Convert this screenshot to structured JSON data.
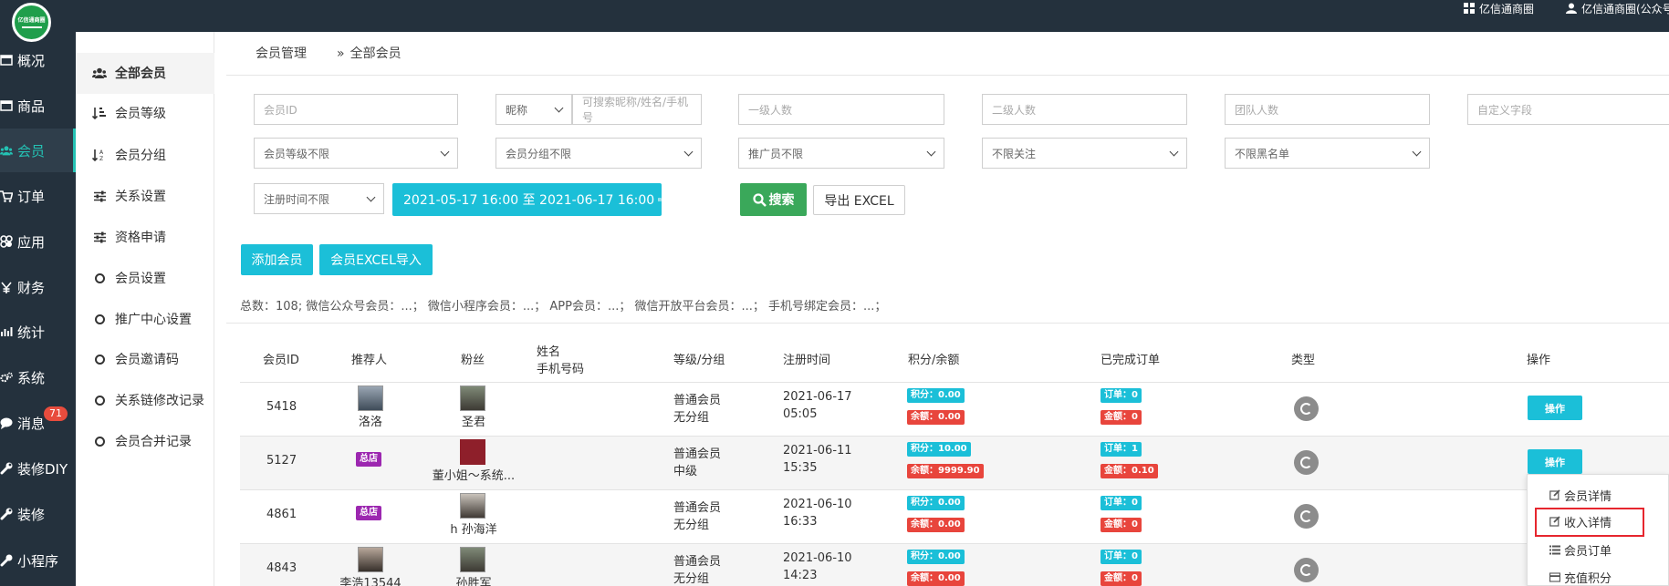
{
  "topbar": {
    "shop_link": "亿信通商圈",
    "account_link": "亿信通商圈(公众号"
  },
  "logo": {
    "text": "亿信通商圈"
  },
  "nav": [
    {
      "label": "概况",
      "icon": "dashboard-icon"
    },
    {
      "label": "商品",
      "icon": "goods-icon"
    },
    {
      "label": "会员",
      "icon": "users-icon",
      "active": true
    },
    {
      "label": "订单",
      "icon": "cart-icon"
    },
    {
      "label": "应用",
      "icon": "apps-icon"
    },
    {
      "label": "财务",
      "icon": "yen-icon"
    },
    {
      "label": "统计",
      "icon": "bar-chart-icon"
    },
    {
      "label": "系统",
      "icon": "gears-icon"
    },
    {
      "label": "消息",
      "icon": "chat-icon",
      "badge": "71"
    },
    {
      "label": "装修DIY",
      "icon": "wrench-icon"
    },
    {
      "label": "装修",
      "icon": "wrench-icon"
    },
    {
      "label": "小程序",
      "icon": "mini-program-icon"
    }
  ],
  "subnav": [
    {
      "label": "全部会员",
      "icon": "users-icon",
      "active": true
    },
    {
      "label": "会员等级",
      "icon": "sort-amount-icon"
    },
    {
      "label": "会员分组",
      "icon": "sort-alpha-icon"
    },
    {
      "label": "关系设置",
      "icon": "sliders-icon"
    },
    {
      "label": "资格申请",
      "icon": "sliders-icon"
    },
    {
      "label": "会员设置",
      "icon": "circle-icon"
    },
    {
      "label": "推广中心设置",
      "icon": "circle-icon"
    },
    {
      "label": "会员邀请码",
      "icon": "circle-icon"
    },
    {
      "label": "关系链修改记录",
      "icon": "circle-icon"
    },
    {
      "label": "会员合并记录",
      "icon": "circle-icon"
    }
  ],
  "breadcrumb": {
    "parent": "会员管理",
    "separator": "»",
    "current": "全部会员"
  },
  "filters": {
    "member_id_placeholder": "会员ID",
    "nickname_select": "昵称",
    "nickname_placeholder": "可搜索昵称/姓名/手机号",
    "level1_placeholder": "一级人数",
    "level2_placeholder": "二级人数",
    "team_placeholder": "团队人数",
    "custom_placeholder": "自定义字段",
    "member_level_select": "会员等级不限",
    "member_group_select": "会员分组不限",
    "promoter_select": "推广员不限",
    "follow_select": "不限关注",
    "blacklist_select": "不限黑名单",
    "register_time_select": "注册时间不限",
    "date_range": "2021-05-17 16:00 至 2021-06-17 16:00",
    "search_button": "搜索",
    "export_button": "导出 EXCEL"
  },
  "actions": {
    "add_member": "添加会员",
    "import_excel": "会员EXCEL导入"
  },
  "summary": "总数：108; 微信公众号会员：...； 微信小程序会员：...； APP会员：...； 微信开放平台会员：...； 手机号绑定会员：...；",
  "table": {
    "headers": {
      "member_id": "会员ID",
      "referrer": "推荐人",
      "fans": "粉丝",
      "name": "姓名",
      "phone": "手机号码",
      "level_group": "等级/分组",
      "register_time": "注册时间",
      "points_balance": "积分/余额",
      "orders": "已完成订单",
      "type": "类型",
      "operation": "操作"
    },
    "rows": [
      {
        "id": "5418",
        "referrer": "洛洛",
        "referrer_badge": "",
        "fan": "圣君",
        "level": "普通会员",
        "group": "无分组",
        "date": "2021-06-17",
        "time": "05:05",
        "points": "积分：0.00",
        "balance": "余额：0.00",
        "order_count": "订单：0",
        "order_amount": "金额：0",
        "op": "操作"
      },
      {
        "id": "5127",
        "referrer": "",
        "referrer_badge": "总店",
        "fan": "董小姐～系统...",
        "level": "普通会员",
        "group": "中级",
        "date": "2021-06-11",
        "time": "15:35",
        "points": "积分：10.00",
        "balance": "余额：9999.90",
        "order_count": "订单：1",
        "order_amount": "金额：0.10",
        "op": "操作"
      },
      {
        "id": "4861",
        "referrer": "",
        "referrer_badge": "总店",
        "fan": "h 孙海洋",
        "level": "普通会员",
        "group": "无分组",
        "date": "2021-06-10",
        "time": "16:33",
        "points": "积分：0.00",
        "balance": "余额：0.00",
        "order_count": "订单：0",
        "order_amount": "金额：0",
        "op": ""
      },
      {
        "id": "4843",
        "referrer": "李浩13544",
        "referrer_badge": "",
        "fan": "孙胜军",
        "level": "普通会员",
        "group": "无分组",
        "date": "2021-06-10",
        "time": "14:23",
        "points": "积分：0.00",
        "balance": "余额：0.00",
        "order_count": "订单：0",
        "order_amount": "金额：0",
        "op": ""
      }
    ]
  },
  "dropdown": [
    {
      "label": "会员详情",
      "icon": "edit-icon"
    },
    {
      "label": "收入详情",
      "icon": "edit-icon",
      "highlighted": true
    },
    {
      "label": "会员订单",
      "icon": "list-icon"
    },
    {
      "label": "充值积分",
      "icon": "credit-card-icon"
    }
  ],
  "colors": {
    "accent": "#1bbfd8",
    "nav_bg": "#24313d",
    "active_nav": "#24c2b4",
    "danger": "#e8453c",
    "success": "#3aa85a",
    "highlight_border": "#e6262e"
  }
}
